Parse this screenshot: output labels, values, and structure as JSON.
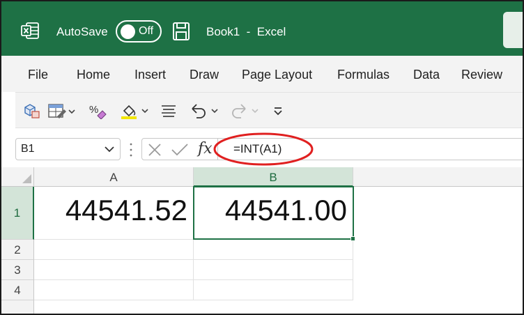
{
  "titlebar": {
    "autosave_label": "AutoSave",
    "autosave_state": "Off",
    "document_title": "Book1  -  Excel",
    "bg_color": "#1e7145"
  },
  "menu": {
    "items": [
      "File",
      "Home",
      "Insert",
      "Draw",
      "Page Layout",
      "Formulas",
      "Data",
      "Review"
    ]
  },
  "ribbon": {
    "icons": [
      "3d-models-icon",
      "table-format-icon",
      "percent-style-icon",
      "fill-color-icon",
      "align-icon",
      "undo-icon",
      "redo-icon",
      "customize-toolbar-icon"
    ]
  },
  "formula_bar": {
    "name_box": "B1",
    "fx_label": "fx",
    "formula": "=INT(A1)"
  },
  "grid": {
    "columns": [
      "A",
      "B"
    ],
    "rows": [
      "1",
      "2",
      "3",
      "4"
    ],
    "selected_column": "B",
    "selected_row": "1",
    "cells": {
      "A1": "44541.52",
      "B1": "44541.00"
    }
  },
  "colors": {
    "accent": "#1e7145",
    "highlight_circle": "#e02020"
  }
}
